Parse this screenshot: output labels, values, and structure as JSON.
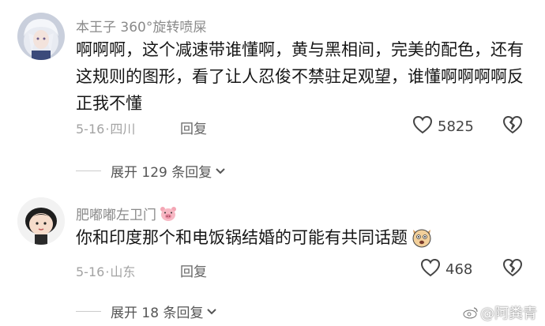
{
  "comments": [
    {
      "username": "本王子 360°旋转喷屎",
      "text": "啊啊啊，这个减速带谁懂啊，黄与黑相间，完美的配色，还有这规则的图形，看了让人忍俊不禁驻足观望，谁懂啊啊啊啊反正我不懂",
      "date": "5-16",
      "location": "四川",
      "reply_label": "回复",
      "likes": "5825",
      "expand_label": "展开 129 条回复"
    },
    {
      "username": "肥嘟嘟左卫门",
      "text": "你和印度那个和电饭锅结婚的可能有共同话题",
      "date": "5-16",
      "location": "山东",
      "reply_label": "回复",
      "likes": "468",
      "expand_label": "展开 18 条回复"
    }
  ],
  "separator": "·",
  "watermark": "@阿粪青",
  "icons": {
    "like": "heart-outline-icon",
    "dislike": "broken-heart-icon",
    "expand": "chevron-down-icon",
    "username_badge": "pig-face-emoji",
    "text_end": "dog-face-emoji"
  }
}
